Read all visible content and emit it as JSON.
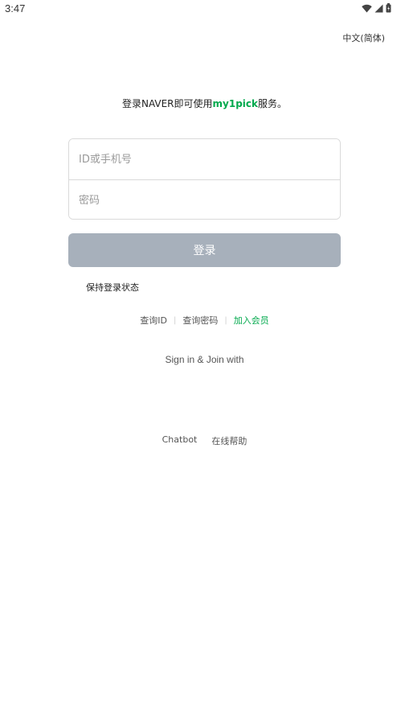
{
  "status_bar": {
    "time": "3:47",
    "icons": [
      "wifi-icon",
      "signal-icon",
      "battery-icon"
    ]
  },
  "language_selector": {
    "label": "中文(简体)"
  },
  "headline": {
    "prefix": "登录NAVER即可使用",
    "brand": "my1pick",
    "suffix": "服务。"
  },
  "login_form": {
    "id_placeholder": "ID或手机号",
    "password_placeholder": "密码",
    "id_value": "",
    "password_value": ""
  },
  "login_button": {
    "label": "登录"
  },
  "keep_login": {
    "label": "保持登录状态"
  },
  "account_links": {
    "find_id": "查询ID",
    "find_password": "查询密码",
    "join": "加入会员",
    "separator": "|"
  },
  "social_login": {
    "label": "Sign in & Join with"
  },
  "footer": {
    "chatbot": "Chatbot",
    "help": "在线帮助"
  },
  "colors": {
    "brand_green": "#03a94d",
    "disabled_button": "#a7b0bb",
    "border": "#dadada"
  }
}
